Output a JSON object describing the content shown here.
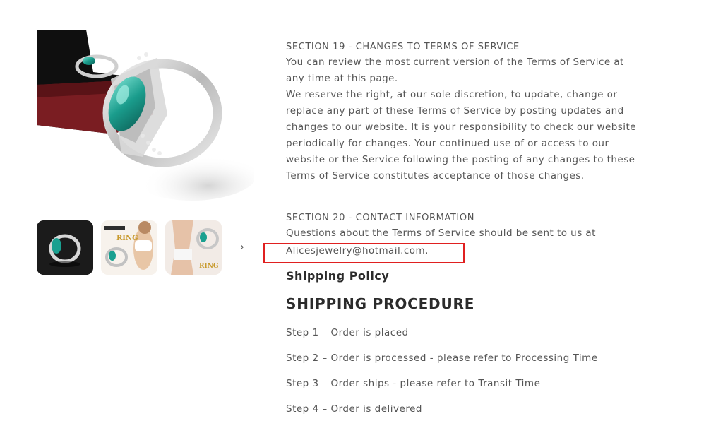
{
  "product": {
    "hero_alt": "silver-ring-with-green-stone-in-box",
    "thumbnails": [
      {
        "name": "ring-on-black"
      },
      {
        "name": "ring-slimming-ad",
        "badge": "RING",
        "caption": "Titanium EM SLIMMING"
      },
      {
        "name": "ring-waist-ad",
        "badge": "RING"
      }
    ],
    "next_icon": "chevron-right-icon"
  },
  "terms": {
    "section19_title": "SECTION 19 - CHANGES TO TERMS OF SERVICE",
    "section19_p1": "You can review the most current version of the Terms of Service at any time at this page.",
    "section19_p2": "We reserve the right, at our sole discretion, to update, change or replace any part of these Terms of Service by posting updates and changes to our website. It is your responsibility to check our website periodically for changes. Your continued use of or access to our website or the Service following the posting of any changes to these Terms of Service constitutes acceptance of those changes.",
    "section20_title": "SECTION 20 - CONTACT INFORMATION",
    "section20_p1": "Questions about the Terms of Service should be sent to us at",
    "email": "Alicesjewelry@hotmail.com."
  },
  "shipping": {
    "policy_heading": "Shipping Policy",
    "procedure_heading": "SHIPPING PROCEDURE",
    "steps": [
      "Step 1 – Order is placed",
      "Step 2 – Order is processed - please refer to Processing Time",
      "Step 3 – Order ships - please refer to Transit Time",
      "Step 4 – Order is delivered"
    ]
  },
  "colors": {
    "highlight": "#e02020",
    "text": "#555555",
    "heading": "#2b2b2b"
  }
}
